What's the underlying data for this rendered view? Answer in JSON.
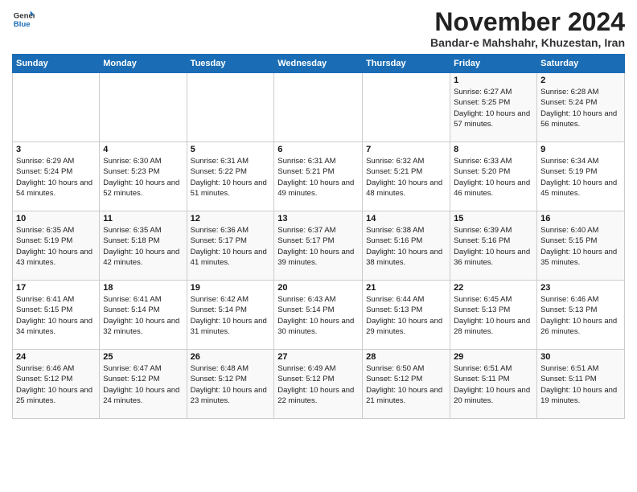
{
  "logo": {
    "line1": "General",
    "line2": "Blue"
  },
  "title": "November 2024",
  "location": "Bandar-e Mahshahr, Khuzestan, Iran",
  "headers": [
    "Sunday",
    "Monday",
    "Tuesday",
    "Wednesday",
    "Thursday",
    "Friday",
    "Saturday"
  ],
  "weeks": [
    [
      {
        "day": "",
        "info": ""
      },
      {
        "day": "",
        "info": ""
      },
      {
        "day": "",
        "info": ""
      },
      {
        "day": "",
        "info": ""
      },
      {
        "day": "",
        "info": ""
      },
      {
        "day": "1",
        "info": "Sunrise: 6:27 AM\nSunset: 5:25 PM\nDaylight: 10 hours and 57 minutes."
      },
      {
        "day": "2",
        "info": "Sunrise: 6:28 AM\nSunset: 5:24 PM\nDaylight: 10 hours and 56 minutes."
      }
    ],
    [
      {
        "day": "3",
        "info": "Sunrise: 6:29 AM\nSunset: 5:24 PM\nDaylight: 10 hours and 54 minutes."
      },
      {
        "day": "4",
        "info": "Sunrise: 6:30 AM\nSunset: 5:23 PM\nDaylight: 10 hours and 52 minutes."
      },
      {
        "day": "5",
        "info": "Sunrise: 6:31 AM\nSunset: 5:22 PM\nDaylight: 10 hours and 51 minutes."
      },
      {
        "day": "6",
        "info": "Sunrise: 6:31 AM\nSunset: 5:21 PM\nDaylight: 10 hours and 49 minutes."
      },
      {
        "day": "7",
        "info": "Sunrise: 6:32 AM\nSunset: 5:21 PM\nDaylight: 10 hours and 48 minutes."
      },
      {
        "day": "8",
        "info": "Sunrise: 6:33 AM\nSunset: 5:20 PM\nDaylight: 10 hours and 46 minutes."
      },
      {
        "day": "9",
        "info": "Sunrise: 6:34 AM\nSunset: 5:19 PM\nDaylight: 10 hours and 45 minutes."
      }
    ],
    [
      {
        "day": "10",
        "info": "Sunrise: 6:35 AM\nSunset: 5:19 PM\nDaylight: 10 hours and 43 minutes."
      },
      {
        "day": "11",
        "info": "Sunrise: 6:35 AM\nSunset: 5:18 PM\nDaylight: 10 hours and 42 minutes."
      },
      {
        "day": "12",
        "info": "Sunrise: 6:36 AM\nSunset: 5:17 PM\nDaylight: 10 hours and 41 minutes."
      },
      {
        "day": "13",
        "info": "Sunrise: 6:37 AM\nSunset: 5:17 PM\nDaylight: 10 hours and 39 minutes."
      },
      {
        "day": "14",
        "info": "Sunrise: 6:38 AM\nSunset: 5:16 PM\nDaylight: 10 hours and 38 minutes."
      },
      {
        "day": "15",
        "info": "Sunrise: 6:39 AM\nSunset: 5:16 PM\nDaylight: 10 hours and 36 minutes."
      },
      {
        "day": "16",
        "info": "Sunrise: 6:40 AM\nSunset: 5:15 PM\nDaylight: 10 hours and 35 minutes."
      }
    ],
    [
      {
        "day": "17",
        "info": "Sunrise: 6:41 AM\nSunset: 5:15 PM\nDaylight: 10 hours and 34 minutes."
      },
      {
        "day": "18",
        "info": "Sunrise: 6:41 AM\nSunset: 5:14 PM\nDaylight: 10 hours and 32 minutes."
      },
      {
        "day": "19",
        "info": "Sunrise: 6:42 AM\nSunset: 5:14 PM\nDaylight: 10 hours and 31 minutes."
      },
      {
        "day": "20",
        "info": "Sunrise: 6:43 AM\nSunset: 5:14 PM\nDaylight: 10 hours and 30 minutes."
      },
      {
        "day": "21",
        "info": "Sunrise: 6:44 AM\nSunset: 5:13 PM\nDaylight: 10 hours and 29 minutes."
      },
      {
        "day": "22",
        "info": "Sunrise: 6:45 AM\nSunset: 5:13 PM\nDaylight: 10 hours and 28 minutes."
      },
      {
        "day": "23",
        "info": "Sunrise: 6:46 AM\nSunset: 5:13 PM\nDaylight: 10 hours and 26 minutes."
      }
    ],
    [
      {
        "day": "24",
        "info": "Sunrise: 6:46 AM\nSunset: 5:12 PM\nDaylight: 10 hours and 25 minutes."
      },
      {
        "day": "25",
        "info": "Sunrise: 6:47 AM\nSunset: 5:12 PM\nDaylight: 10 hours and 24 minutes."
      },
      {
        "day": "26",
        "info": "Sunrise: 6:48 AM\nSunset: 5:12 PM\nDaylight: 10 hours and 23 minutes."
      },
      {
        "day": "27",
        "info": "Sunrise: 6:49 AM\nSunset: 5:12 PM\nDaylight: 10 hours and 22 minutes."
      },
      {
        "day": "28",
        "info": "Sunrise: 6:50 AM\nSunset: 5:12 PM\nDaylight: 10 hours and 21 minutes."
      },
      {
        "day": "29",
        "info": "Sunrise: 6:51 AM\nSunset: 5:11 PM\nDaylight: 10 hours and 20 minutes."
      },
      {
        "day": "30",
        "info": "Sunrise: 6:51 AM\nSunset: 5:11 PM\nDaylight: 10 hours and 19 minutes."
      }
    ]
  ]
}
